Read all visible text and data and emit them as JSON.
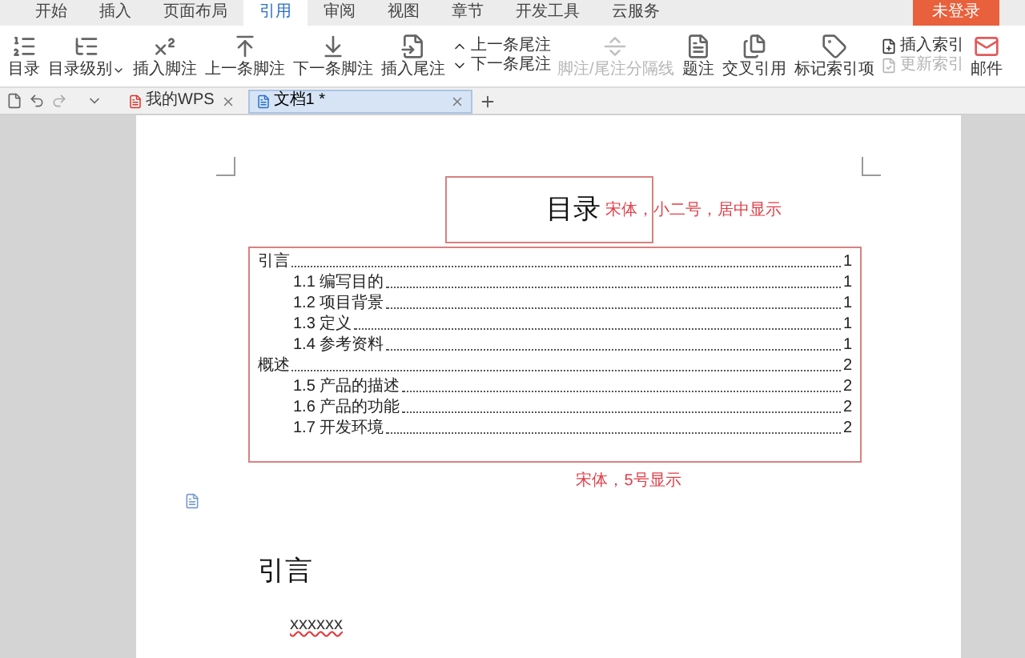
{
  "menu_tabs": [
    {
      "label": "开始",
      "selected": false
    },
    {
      "label": "插入",
      "selected": false
    },
    {
      "label": "页面布局",
      "selected": false
    },
    {
      "label": "引用",
      "selected": true
    },
    {
      "label": "审阅",
      "selected": false
    },
    {
      "label": "视图",
      "selected": false
    },
    {
      "label": "章节",
      "selected": false
    },
    {
      "label": "开发工具",
      "selected": false
    },
    {
      "label": "云服务",
      "selected": false
    }
  ],
  "login_button": "未登录",
  "ribbon": [
    {
      "kind": "large",
      "label": "目录",
      "disabled": false
    },
    {
      "kind": "dropdown",
      "label": "目录级别",
      "disabled": false
    },
    {
      "kind": "large",
      "label": "插入脚注",
      "disabled": false
    },
    {
      "kind": "large",
      "label": "上一条脚注",
      "disabled": false
    },
    {
      "kind": "large",
      "label": "下一条脚注",
      "disabled": false
    },
    {
      "kind": "large",
      "label": "插入尾注",
      "disabled": false
    },
    {
      "kind": "stack",
      "items": [
        {
          "label": "上一条尾注",
          "disabled": false
        },
        {
          "label": "下一条尾注",
          "disabled": false
        }
      ]
    },
    {
      "kind": "large",
      "label": "脚注/尾注分隔线",
      "disabled": true
    },
    {
      "kind": "large",
      "label": "题注",
      "disabled": false
    },
    {
      "kind": "large",
      "label": "交叉引用",
      "disabled": false
    },
    {
      "kind": "large",
      "label": "标记索引项",
      "disabled": false
    },
    {
      "kind": "stack",
      "items": [
        {
          "label": "插入索引",
          "disabled": false
        },
        {
          "label": "更新索引",
          "disabled": true
        }
      ]
    },
    {
      "kind": "mail",
      "label": "邮件",
      "disabled": false
    }
  ],
  "doc_tabs": [
    {
      "label": "我的WPS",
      "selected": false
    },
    {
      "label": "文档1 *",
      "selected": true
    }
  ],
  "document": {
    "toc_title": "目录",
    "title_note": "宋体，小二号，居中显示",
    "toc": [
      {
        "label": "引言",
        "page": "1",
        "children": [
          {
            "label": "1.1 编写目的",
            "page": "1"
          },
          {
            "label": "1.2 项目背景",
            "page": "1"
          },
          {
            "label": "1.3 定义",
            "page": "1"
          },
          {
            "label": "1.4 参考资料",
            "page": "1"
          }
        ]
      },
      {
        "label": "概述",
        "page": "2",
        "children": [
          {
            "label": "1.5 产品的描述",
            "page": "2"
          },
          {
            "label": "1.6 产品的功能",
            "page": "2"
          },
          {
            "label": "1.7 开发环境",
            "page": "2"
          }
        ]
      }
    ],
    "toc_note": "宋体，5号显示",
    "heading": "引言",
    "body": "xxxxxx"
  }
}
